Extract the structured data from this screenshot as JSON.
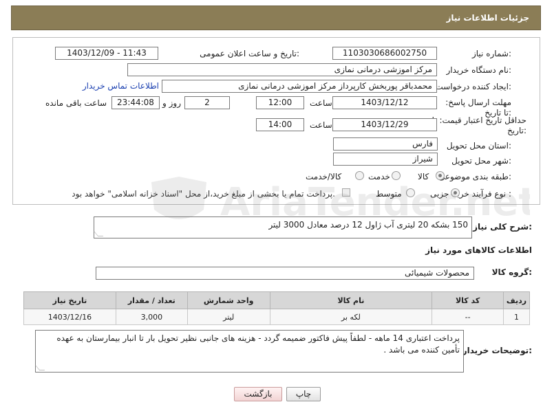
{
  "header": {
    "title": "جزئیات اطلاعات نیاز"
  },
  "form": {
    "need_number_label": "شماره نیاز:",
    "need_number": "1103030686002750",
    "announce_label": "تاریخ و ساعت اعلان عمومی:",
    "announce_value": "1403/12/09 - 11:43",
    "buyer_org_label": "نام دستگاه خریدار:",
    "buyer_org": "مرکز اموزشی درمانی نمازی",
    "requester_label": "ایجاد کننده درخواست:",
    "requester": "محمدباقر پوربخش کارپرداز مرکز اموزشی درمانی نمازی",
    "contact_link": "اطلاعات تماس خریدار",
    "deadline_label": "مهلت ارسال پاسخ: تا تاریخ:",
    "deadline_date": "1403/12/12",
    "time_label": "ساعت",
    "deadline_time": "12:00",
    "days_remaining": "2",
    "day_and_label": "روز و",
    "time_remaining": "23:44:08",
    "remaining_label": "ساعت باقی مانده",
    "validity_label": "حداقل تاریخ اعتبار قیمت: تا تاریخ:",
    "validity_date": "1403/12/29",
    "validity_time": "14:00",
    "province_label": "استان محل تحویل:",
    "province": "فارس",
    "city_label": "شهر محل تحویل:",
    "city": "شیراز",
    "category_label": "طبقه بندی موضوعی:",
    "category_options": [
      "کالا",
      "خدمت",
      "کالا/خدمت"
    ],
    "category_selected": "کالا",
    "process_label": "نوع فرآیند خرید :",
    "process_options": [
      "جزیی",
      "متوسط"
    ],
    "process_selected": "جزیی",
    "payment_note": "پرداخت تمام یا بخشی از مبلغ خرید،از محل \"اسناد خزانه اسلامی\" خواهد بود."
  },
  "description": {
    "label": "شرح کلی نیاز:",
    "text": "150 بشکه 20 لیتری آب ژاول 12 درصد معادل 3000 لیتر"
  },
  "goods_section": {
    "title": "اطلاعات کالاهای مورد نیاز",
    "group_label": "گروه کالا:",
    "group_value": "محصولات شیمیائی"
  },
  "table": {
    "headers": [
      "ردیف",
      "کد کالا",
      "نام کالا",
      "واحد شمارش",
      "تعداد / مقدار",
      "تاریخ نیاز"
    ],
    "rows": [
      [
        "1",
        "--",
        "لکه بر",
        "لیتر",
        "3,000",
        "1403/12/16"
      ]
    ]
  },
  "buyer_notes": {
    "label": "توضیحات خریدار:",
    "text": "پرداخت اعتباری 14 ماهه - لطفاً پیش فاکتور ضمیمه گردد - هزینه های جانبی نظیر تحویل بار تا انبار بیمارستان به عهده تأمین کننده می باشد ."
  },
  "buttons": {
    "print": "چاپ",
    "back": "بازگشت"
  },
  "watermark": "AriaTender.net"
}
